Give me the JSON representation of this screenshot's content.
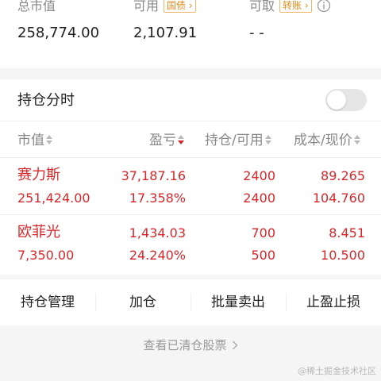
{
  "summary": {
    "total_value": {
      "label": "总市值",
      "value": "258,774.00"
    },
    "available": {
      "label": "可用",
      "tag": "国债",
      "value": "2,107.91"
    },
    "withdrawable": {
      "label": "可取",
      "tag": "转账",
      "value": "- -"
    }
  },
  "holdings": {
    "title": "持仓分时",
    "toggle_on": false,
    "columns": [
      {
        "label": "市值",
        "sort": "none"
      },
      {
        "label": "盈亏",
        "sort": "desc"
      },
      {
        "label": "持仓/可用",
        "sort": "none"
      },
      {
        "label": "成本/现价",
        "sort": "none"
      }
    ],
    "rows": [
      {
        "name": "赛力斯",
        "market_value": "251,424.00",
        "profit": "37,187.16",
        "profit_pct": "17.358%",
        "position": "2400",
        "available": "2400",
        "cost": "89.265",
        "price": "104.760"
      },
      {
        "name": "欧菲光",
        "market_value": "7,350.00",
        "profit": "1,434.03",
        "profit_pct": "24.240%",
        "position": "700",
        "available": "500",
        "cost": "8.451",
        "price": "10.500"
      }
    ]
  },
  "actions": [
    {
      "label": "持仓管理"
    },
    {
      "label": "加仓"
    },
    {
      "label": "批量卖出"
    },
    {
      "label": "止盈止损"
    }
  ],
  "cleared_link": "查看已清仓股票",
  "watermark": "@稀土掘金技术社区",
  "colors": {
    "profit_red": "#d9262a",
    "tag_orange": "#e08a1a",
    "muted": "#888888"
  }
}
